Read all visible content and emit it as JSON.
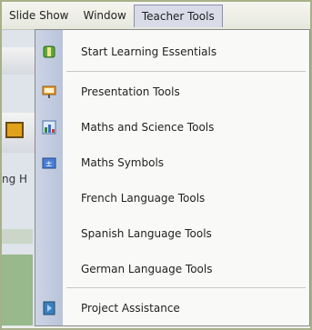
{
  "menubar": {
    "items": [
      {
        "label": "Slide Show"
      },
      {
        "label": "Window"
      },
      {
        "label": "Teacher Tools"
      }
    ]
  },
  "background": {
    "partial_text": "ng H"
  },
  "dropdown": {
    "items": [
      {
        "label": "Start Learning Essentials",
        "icon": "book-green-icon"
      },
      {
        "label": "Presentation Tools",
        "icon": "presentation-icon"
      },
      {
        "label": "Maths and Science Tools",
        "icon": "chart-icon"
      },
      {
        "label": "Maths Symbols",
        "icon": "symbols-icon"
      },
      {
        "label": "French Language Tools",
        "icon": null
      },
      {
        "label": "Spanish Language Tools",
        "icon": null
      },
      {
        "label": "German Language Tools",
        "icon": null
      },
      {
        "label": "Project Assistance",
        "icon": "project-icon"
      }
    ]
  }
}
